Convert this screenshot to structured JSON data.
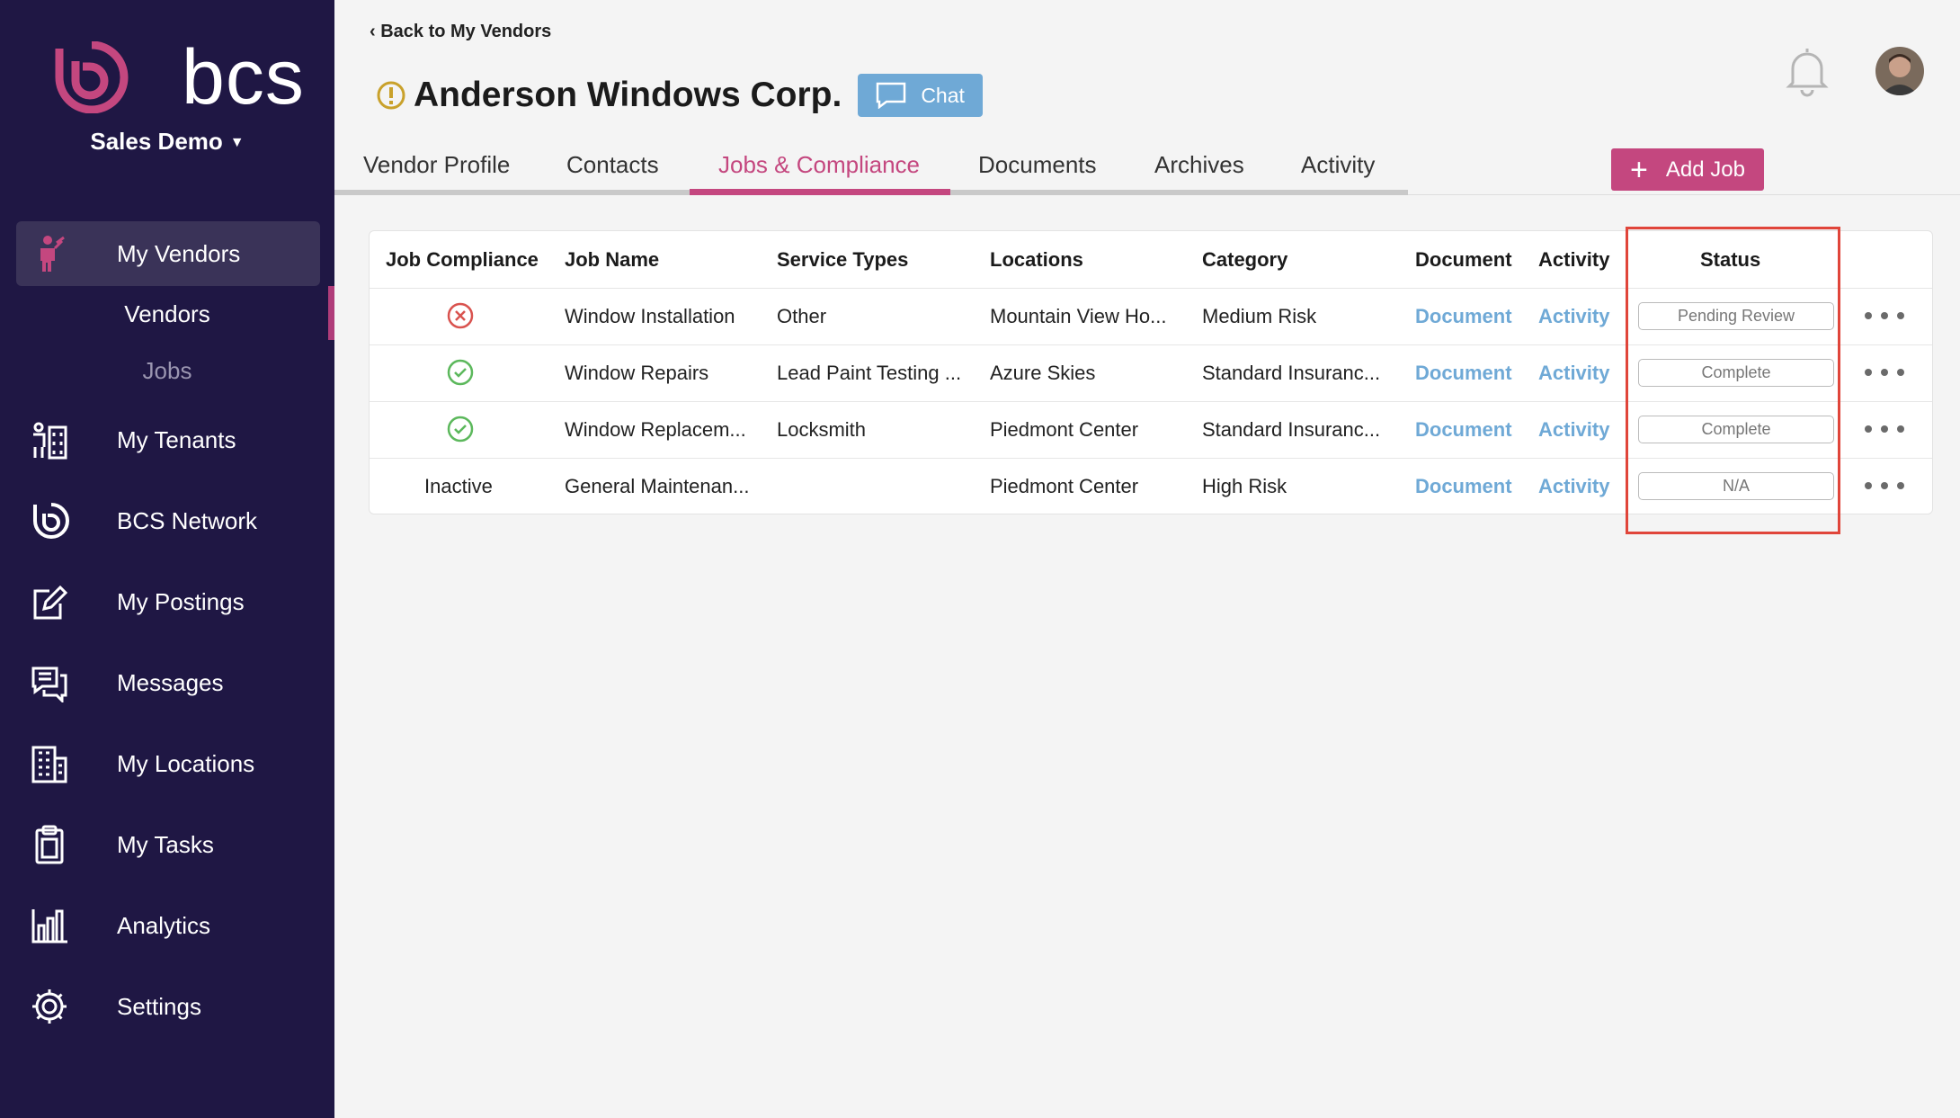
{
  "sidebar": {
    "brand": "bcs",
    "org": "Sales Demo",
    "items": [
      {
        "label": "My Vendors"
      },
      {
        "label": "My Tenants"
      },
      {
        "label": "BCS Network"
      },
      {
        "label": "My Postings"
      },
      {
        "label": "Messages"
      },
      {
        "label": "My Locations"
      },
      {
        "label": "My Tasks"
      },
      {
        "label": "Analytics"
      },
      {
        "label": "Settings"
      }
    ],
    "subitems": [
      {
        "label": "Vendors"
      },
      {
        "label": "Jobs"
      }
    ]
  },
  "header": {
    "back_link": "‹ Back to My Vendors",
    "vendor_name": "Anderson Windows Corp.",
    "chat_label": "Chat"
  },
  "tabs": [
    {
      "label": "Vendor Profile"
    },
    {
      "label": "Contacts"
    },
    {
      "label": "Jobs & Compliance"
    },
    {
      "label": "Documents"
    },
    {
      "label": "Archives"
    },
    {
      "label": "Activity"
    }
  ],
  "active_tab": "Jobs & Compliance",
  "add_job_label": "Add Job",
  "table": {
    "columns": [
      "Job Compliance",
      "Job Name",
      "Service Types",
      "Locations",
      "Category",
      "Document",
      "Activity",
      "Status"
    ],
    "rows": [
      {
        "compliance": "non-compliant",
        "compliance_text": "",
        "job_name": "Window Installation",
        "service_types": "Other",
        "locations": "Mountain View Ho...",
        "category": "Medium Risk",
        "document": "Document",
        "activity": "Activity",
        "status": "Pending Review"
      },
      {
        "compliance": "compliant",
        "compliance_text": "",
        "job_name": "Window Repairs",
        "service_types": "Lead Paint Testing ...",
        "locations": "Azure Skies",
        "category": "Standard Insuranc...",
        "document": "Document",
        "activity": "Activity",
        "status": "Complete"
      },
      {
        "compliance": "compliant",
        "compliance_text": "",
        "job_name": "Window Replacem...",
        "service_types": "Locksmith",
        "locations": "Piedmont Center",
        "category": "Standard Insuranc...",
        "document": "Document",
        "activity": "Activity",
        "status": "Complete"
      },
      {
        "compliance": "inactive",
        "compliance_text": "Inactive",
        "job_name": "General Maintenan...",
        "service_types": "",
        "locations": "Piedmont Center",
        "category": "High Risk",
        "document": "Document",
        "activity": "Activity",
        "status": "N/A"
      }
    ]
  },
  "colors": {
    "sidebar_bg": "#1f1744",
    "accent": "#c4477f",
    "link": "#6fa9d6",
    "compliant": "#5cb85c",
    "non_compliant": "#d9534f",
    "highlight": "#e0453a"
  }
}
